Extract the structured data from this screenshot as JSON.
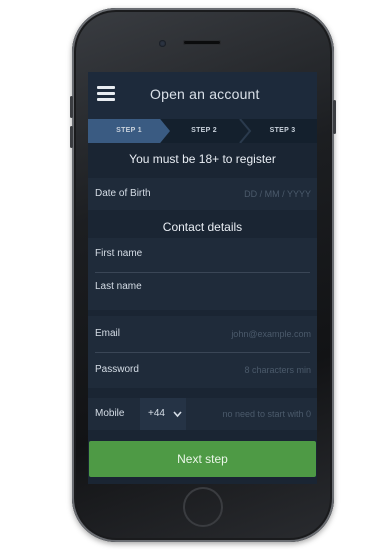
{
  "screen": {
    "title": "Open an account",
    "steps": [
      "STEP 1",
      "STEP 2",
      "STEP 3"
    ],
    "active_step": 1,
    "age_notice": "You must be 18+ to register",
    "dob": {
      "label": "Date of Birth",
      "placeholder": "DD / MM / YYYY"
    },
    "contact_heading": "Contact details",
    "first_name": {
      "label": "First name"
    },
    "last_name": {
      "label": "Last name"
    },
    "email": {
      "label": "Email",
      "placeholder": "john@example.com"
    },
    "password": {
      "label": "Password",
      "placeholder": "8 characters min"
    },
    "mobile": {
      "label": "Mobile",
      "code": "+44",
      "placeholder": "no need to start with 0"
    },
    "next_label": "Next step"
  },
  "colors": {
    "screen_bg": "#1a2533",
    "active_step": "#3a5b82",
    "next_button": "#4e9a45"
  },
  "icons": [
    "hamburger-menu-icon",
    "chevron-down-icon"
  ]
}
